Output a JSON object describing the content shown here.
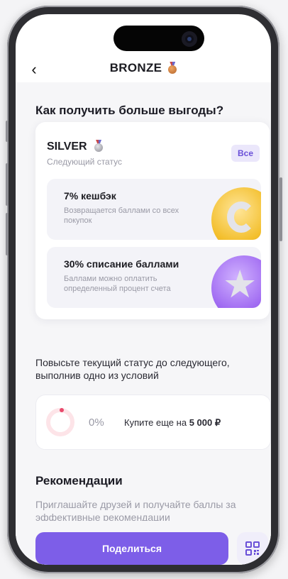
{
  "header": {
    "back_icon": "chevron-left-icon",
    "title": "BRONZE",
    "medal_icon": "bronze-medal-icon"
  },
  "section_title": "Как получить больше выгоды?",
  "status_card": {
    "name": "SILVER",
    "medal_icon": "silver-medal-icon",
    "subtitle": "Следующий статус",
    "all_button": "Все",
    "benefits": [
      {
        "title": "7% кешбэк",
        "description": "Возвращается баллами со всех покупок",
        "icon": "gold-coin-icon"
      },
      {
        "title": "30% списание баллами",
        "description": "Баллами можно оплатить определенный процент счета",
        "icon": "star-coin-icon"
      }
    ]
  },
  "upgrade_text": "Повысьте текущий статус до следующего, выполнив одно из условий",
  "progress": {
    "percent_label": "0%",
    "value": 0,
    "buy_prefix": "Купите еще на",
    "buy_amount": "5 000 ₽"
  },
  "recommendations": {
    "title": "Рекомендации",
    "text": "Приглашайте друзей и получайте баллы за эффективные рекомендации",
    "share_button": "Поделиться",
    "qr_icon": "qr-code-icon"
  },
  "colors": {
    "accent": "#7d5ee8",
    "accent_light": "#ebe7fb",
    "progress_ring": "#e84a6c"
  }
}
